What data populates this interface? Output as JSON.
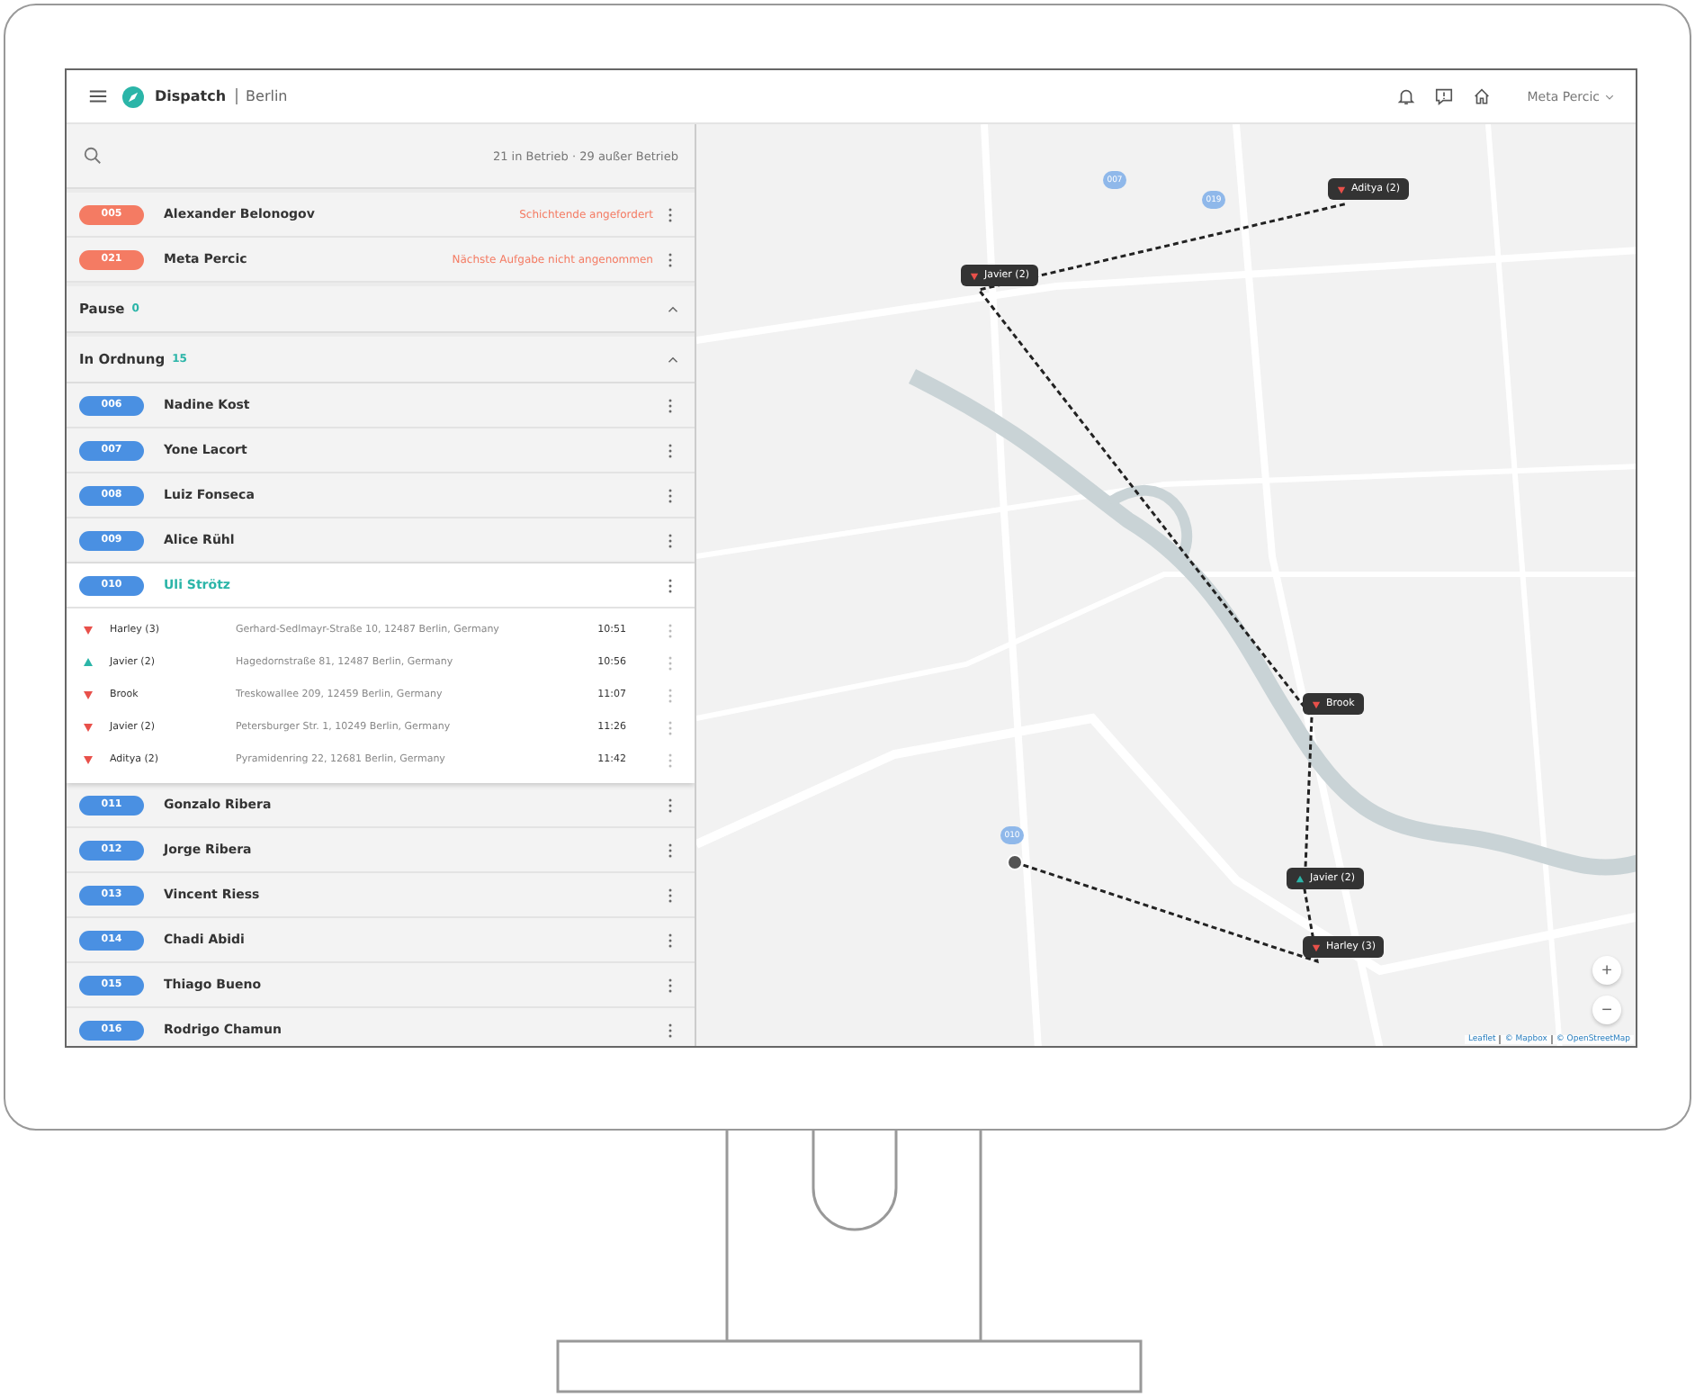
{
  "header": {
    "app": "Dispatch",
    "city": "Berlin",
    "user": "Meta Percic"
  },
  "panel": {
    "summary": "21 in Betrieb · 29 außer Betrieb",
    "alerts": [
      {
        "id": "005",
        "name": "Alexander Belonogov",
        "status": "Schichtende angefordert"
      },
      {
        "id": "021",
        "name": "Meta Percic",
        "status": "Nächste Aufgabe nicht angenommen"
      }
    ],
    "groups": [
      {
        "title": "Pause",
        "count": "0",
        "expanded": true
      },
      {
        "title": "In Ordnung",
        "count": "15",
        "expanded": true,
        "drivers": [
          {
            "id": "006",
            "name": "Nadine Kost",
            "selected": false
          },
          {
            "id": "007",
            "name": "Yone Lacort",
            "selected": false
          },
          {
            "id": "008",
            "name": "Luiz Fonseca",
            "selected": false
          },
          {
            "id": "009",
            "name": "Alice Rühl",
            "selected": false
          },
          {
            "id": "010",
            "name": "Uli Strötz",
            "selected": true,
            "stops": [
              {
                "name": "Harley (3)",
                "address": "Gerhard-Sedlmayr-Straße 10, 12487 Berlin, Germany",
                "time": "10:51",
                "kind": "dropoff"
              },
              {
                "name": "Javier (2)",
                "address": "Hagedornstraße 81, 12487 Berlin, Germany",
                "time": "10:56",
                "kind": "pickup"
              },
              {
                "name": "Brook",
                "address": "Treskowallee 209, 12459 Berlin, Germany",
                "time": "11:07",
                "kind": "dropoff"
              },
              {
                "name": "Javier (2)",
                "address": "Petersburger Str. 1, 10249 Berlin, Germany",
                "time": "11:26",
                "kind": "dropoff"
              },
              {
                "name": "Aditya (2)",
                "address": "Pyramidenring 22, 12681 Berlin, Germany",
                "time": "11:42",
                "kind": "dropoff"
              }
            ]
          },
          {
            "id": "011",
            "name": "Gonzalo Ribera",
            "selected": false
          },
          {
            "id": "012",
            "name": "Jorge Ribera",
            "selected": false
          },
          {
            "id": "013",
            "name": "Vincent Riess",
            "selected": false
          },
          {
            "id": "014",
            "name": "Chadi Abidi",
            "selected": false
          },
          {
            "id": "015",
            "name": "Thiago Bueno",
            "selected": false
          },
          {
            "id": "016",
            "name": "Rodrigo Chamun",
            "selected": false
          }
        ]
      }
    ]
  },
  "map": {
    "markers": [
      {
        "label": "Aditya (2)",
        "kind": "dropoff"
      },
      {
        "label": "Javier (2)",
        "kind": "dropoff"
      },
      {
        "label": "Brook",
        "kind": "dropoff"
      },
      {
        "label": "Javier (2)",
        "kind": "pickup"
      },
      {
        "label": "Harley (3)",
        "kind": "dropoff"
      }
    ],
    "vehicles": [
      {
        "label": "007"
      },
      {
        "label": "019"
      },
      {
        "label": "010"
      }
    ],
    "zoom": [
      "+",
      "−"
    ],
    "attribution": [
      "Leaflet",
      "© Mapbox",
      "© OpenStreetMap"
    ]
  }
}
